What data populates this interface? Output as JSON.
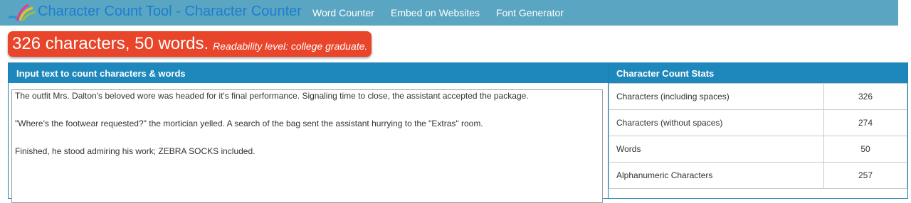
{
  "navbar": {
    "brand": "Character Count Tool - Character Counter",
    "links": [
      "Word Counter",
      "Embed on Websites",
      "Font Generator"
    ],
    "logo_icon": "colorful-feather-logo-icon",
    "bg_color": "#5aa5c1"
  },
  "banner": {
    "summary": "326 characters, 50 words.",
    "readability": "Readability level: college graduate.",
    "color": "#e8452a"
  },
  "input_panel": {
    "title": "Input text to count characters & words",
    "text": [
      "The outfit Mrs. Dalton's beloved wore was headed for it's final performance. Signaling time to close, the assistant accepted the package.",
      "\"Where's the footwear requested?\" the mortician yelled.  A search of the bag sent the assistant hurrying to the \"Extras\" room.",
      "Finished, he stood admiring his work; ZEBRA SOCKS included."
    ]
  },
  "stats_panel": {
    "title": "Character Count Stats",
    "rows": [
      {
        "label": "Characters (including spaces)",
        "value": "326"
      },
      {
        "label": "Characters (without spaces)",
        "value": "274"
      },
      {
        "label": "Words",
        "value": "50"
      },
      {
        "label": "Alphanumeric Characters",
        "value": "257"
      }
    ]
  }
}
